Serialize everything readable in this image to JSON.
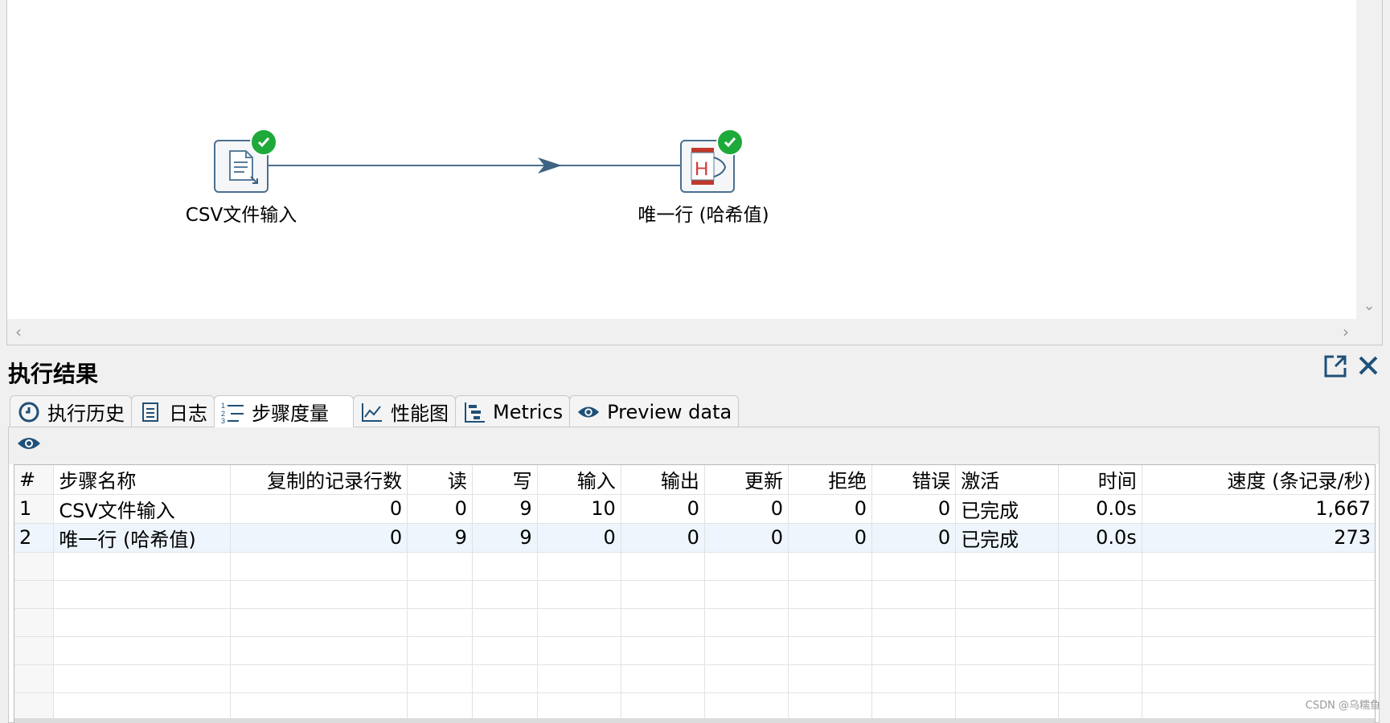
{
  "canvas": {
    "steps": [
      {
        "name": "csv-input",
        "label": "CSV文件输入",
        "status": "ok"
      },
      {
        "name": "unique-rows-hash",
        "label": "唯一行 (哈希值)",
        "status": "ok"
      }
    ],
    "hop_color": "#4c6f8e"
  },
  "panel": {
    "title": "执行结果",
    "tabs": [
      {
        "label": "执行历史",
        "icon": "history-icon"
      },
      {
        "label": "日志",
        "icon": "log-icon"
      },
      {
        "label": "步骤度量",
        "icon": "step-metrics-icon",
        "active": true
      },
      {
        "label": "性能图",
        "icon": "performance-chart-icon"
      },
      {
        "label": "Metrics",
        "icon": "metrics-icon"
      },
      {
        "label": "Preview data",
        "icon": "eye-icon"
      }
    ]
  },
  "table": {
    "columns": [
      "#",
      "步骤名称",
      "复制的记录行数",
      "读",
      "写",
      "输入",
      "输出",
      "更新",
      "拒绝",
      "错误",
      "激活",
      "时间",
      "速度 (条记录/秒)"
    ],
    "rows": [
      [
        "1",
        "CSV文件输入",
        "0",
        "0",
        "9",
        "10",
        "0",
        "0",
        "0",
        "0",
        "已完成",
        "0.0s",
        "1,667"
      ],
      [
        "2",
        "唯一行 (哈希值)",
        "0",
        "9",
        "9",
        "0",
        "0",
        "0",
        "0",
        "0",
        "已完成",
        "0.0s",
        "273"
      ]
    ]
  },
  "watermark": "CSDN @乌糯鱼",
  "colors": {
    "accent": "#1f5078",
    "ok_green": "#1ea93b",
    "selected_row": "#eef5fc"
  }
}
